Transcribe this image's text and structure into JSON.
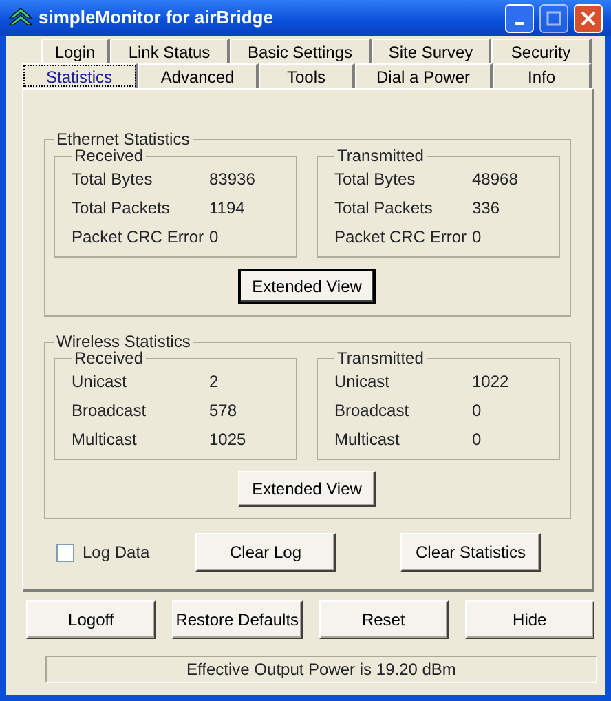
{
  "window": {
    "title": "simpleMonitor for airBridge"
  },
  "tab_rows": [
    {
      "tabs": [
        {
          "label": "Login",
          "selected": false
        },
        {
          "label": "Link Status",
          "selected": false
        },
        {
          "label": "Basic Settings",
          "selected": false
        },
        {
          "label": "Site Survey",
          "selected": false
        },
        {
          "label": "Security",
          "selected": false
        }
      ]
    },
    {
      "tabs": [
        {
          "label": "Statistics",
          "selected": true
        },
        {
          "label": "Advanced",
          "selected": false
        },
        {
          "label": "Tools",
          "selected": false
        },
        {
          "label": "Dial a Power",
          "selected": false
        },
        {
          "label": "Info",
          "selected": false
        }
      ]
    }
  ],
  "groups": [
    {
      "title": "Ethernet Statistics",
      "sections": [
        {
          "title": "Received",
          "rows": [
            {
              "label": "Total Bytes",
              "value": "83936"
            },
            {
              "label": "Total Packets",
              "value": "1194"
            },
            {
              "label": "Packet CRC Error",
              "value": "0"
            }
          ]
        },
        {
          "title": "Transmitted",
          "rows": [
            {
              "label": "Total Bytes",
              "value": "48968"
            },
            {
              "label": "Total Packets",
              "value": "336"
            },
            {
              "label": "Packet CRC Error",
              "value": "0"
            }
          ]
        }
      ],
      "button": "Extended View",
      "focused": true
    },
    {
      "title": "Wireless Statistics",
      "sections": [
        {
          "title": "Received",
          "rows": [
            {
              "label": "Unicast",
              "value": "2"
            },
            {
              "label": "Broadcast",
              "value": "578"
            },
            {
              "label": "Multicast",
              "value": "1025"
            }
          ]
        },
        {
          "title": "Transmitted",
          "rows": [
            {
              "label": "Unicast",
              "value": "1022"
            },
            {
              "label": "Broadcast",
              "value": "0"
            },
            {
              "label": "Multicast",
              "value": "0"
            }
          ]
        }
      ],
      "button": "Extended View",
      "focused": false
    }
  ],
  "log_data": {
    "label": "Log Data",
    "checked": false
  },
  "panel_buttons": [
    "Clear Log",
    "Clear Statistics"
  ],
  "buttons": [
    "Logoff",
    "Restore Defaults",
    "Reset",
    "Hide"
  ],
  "status": "Effective Output Power is 19.20 dBm"
}
